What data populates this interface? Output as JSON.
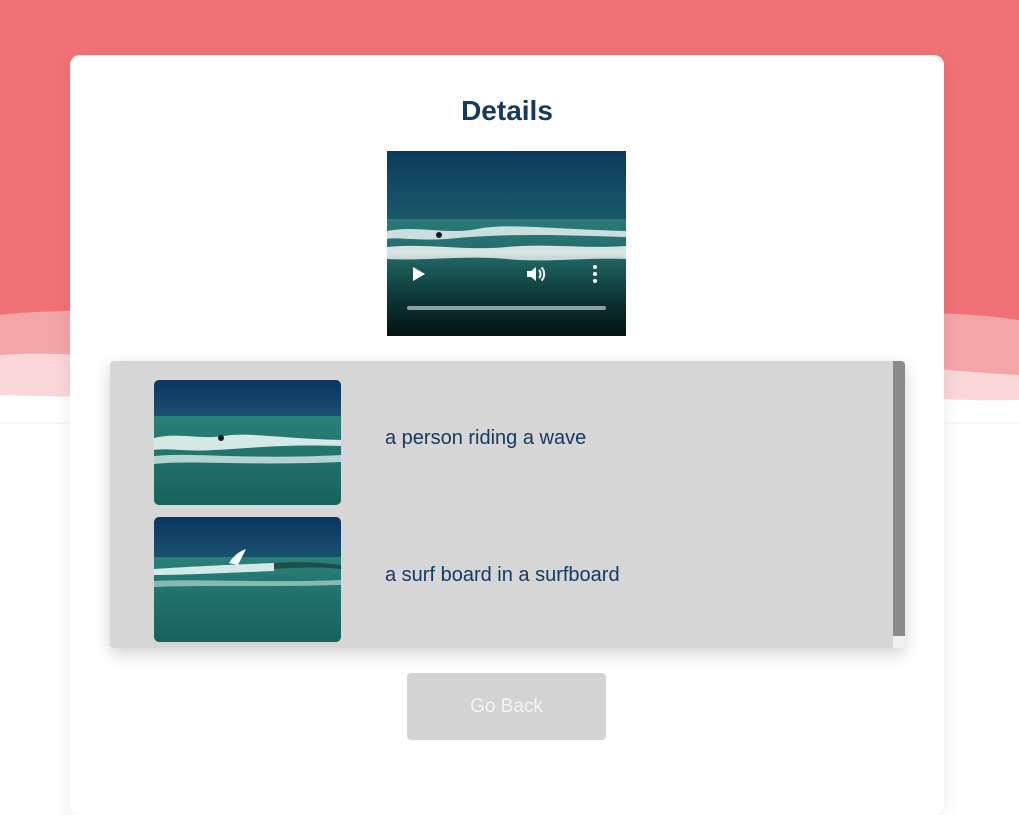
{
  "colors": {
    "header_bg": "#f07276",
    "wave_light": "#f4a5a8",
    "wave_lighter": "#f9d6d8",
    "title": "#153a60",
    "list_bg": "#d6d6d6",
    "button_bg": "#d3d3d3"
  },
  "page": {
    "title": "Details"
  },
  "video_player": {
    "controls": {
      "play_icon": "play-icon",
      "volume_icon": "volume-icon",
      "more_icon": "more-vertical-icon"
    },
    "progress": 0
  },
  "frames": [
    {
      "caption": "a person riding a wave"
    },
    {
      "caption": "a surf board in a surfboard"
    }
  ],
  "actions": {
    "go_back_label": "Go Back"
  }
}
